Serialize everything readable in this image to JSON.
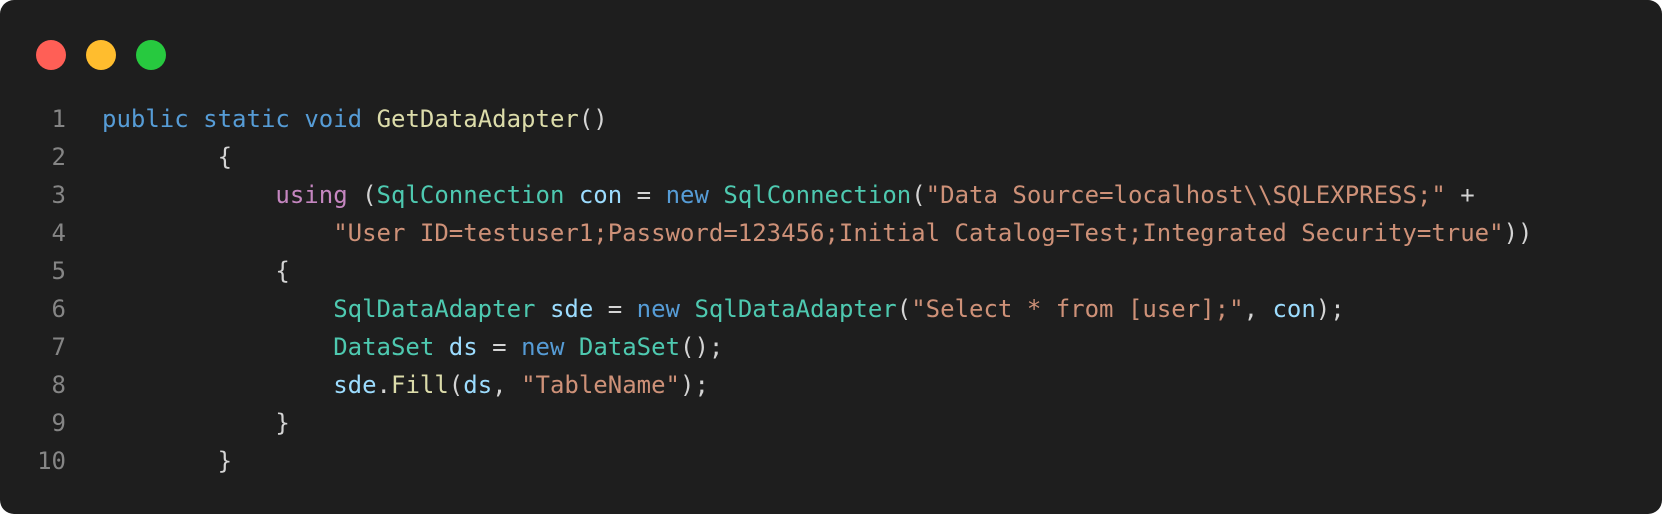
{
  "window": {
    "buttons": [
      {
        "name": "close",
        "color": "#ff5f56"
      },
      {
        "name": "minimize",
        "color": "#ffbd2e"
      },
      {
        "name": "maximize",
        "color": "#27c93f"
      }
    ]
  },
  "code": {
    "language": "csharp",
    "lines": [
      {
        "number": "1",
        "tokens": [
          {
            "t": "public",
            "k": "kw"
          },
          {
            "t": " ",
            "k": "pun"
          },
          {
            "t": "static",
            "k": "kw"
          },
          {
            "t": " ",
            "k": "pun"
          },
          {
            "t": "void",
            "k": "kw"
          },
          {
            "t": " ",
            "k": "pun"
          },
          {
            "t": "GetDataAdapter",
            "k": "fn"
          },
          {
            "t": "()",
            "k": "pun"
          }
        ]
      },
      {
        "number": "2",
        "tokens": [
          {
            "t": "        {",
            "k": "pun"
          }
        ]
      },
      {
        "number": "3",
        "tokens": [
          {
            "t": "            ",
            "k": "pun"
          },
          {
            "t": "using",
            "k": "ctrl"
          },
          {
            "t": " (",
            "k": "pun"
          },
          {
            "t": "SqlConnection",
            "k": "type"
          },
          {
            "t": " ",
            "k": "pun"
          },
          {
            "t": "con",
            "k": "var"
          },
          {
            "t": " = ",
            "k": "pun"
          },
          {
            "t": "new",
            "k": "kw"
          },
          {
            "t": " ",
            "k": "pun"
          },
          {
            "t": "SqlConnection",
            "k": "type"
          },
          {
            "t": "(",
            "k": "pun"
          },
          {
            "t": "\"Data Source=localhost\\\\SQLEXPRESS;\"",
            "k": "str"
          },
          {
            "t": " +",
            "k": "pun"
          }
        ]
      },
      {
        "number": "4",
        "tokens": [
          {
            "t": "                ",
            "k": "pun"
          },
          {
            "t": "\"User ID=testuser1;Password=123456;Initial Catalog=Test;Integrated Security=true\"",
            "k": "str"
          },
          {
            "t": "))",
            "k": "pun"
          }
        ]
      },
      {
        "number": "5",
        "tokens": [
          {
            "t": "            {",
            "k": "pun"
          }
        ]
      },
      {
        "number": "6",
        "tokens": [
          {
            "t": "                ",
            "k": "pun"
          },
          {
            "t": "SqlDataAdapter",
            "k": "type"
          },
          {
            "t": " ",
            "k": "pun"
          },
          {
            "t": "sde",
            "k": "var"
          },
          {
            "t": " = ",
            "k": "pun"
          },
          {
            "t": "new",
            "k": "kw"
          },
          {
            "t": " ",
            "k": "pun"
          },
          {
            "t": "SqlDataAdapter",
            "k": "type"
          },
          {
            "t": "(",
            "k": "pun"
          },
          {
            "t": "\"Select * from [user];\"",
            "k": "str"
          },
          {
            "t": ", ",
            "k": "pun"
          },
          {
            "t": "con",
            "k": "var"
          },
          {
            "t": ");",
            "k": "pun"
          }
        ]
      },
      {
        "number": "7",
        "tokens": [
          {
            "t": "                ",
            "k": "pun"
          },
          {
            "t": "DataSet",
            "k": "type"
          },
          {
            "t": " ",
            "k": "pun"
          },
          {
            "t": "ds",
            "k": "var"
          },
          {
            "t": " = ",
            "k": "pun"
          },
          {
            "t": "new",
            "k": "kw"
          },
          {
            "t": " ",
            "k": "pun"
          },
          {
            "t": "DataSet",
            "k": "type"
          },
          {
            "t": "();",
            "k": "pun"
          }
        ]
      },
      {
        "number": "8",
        "tokens": [
          {
            "t": "                ",
            "k": "pun"
          },
          {
            "t": "sde",
            "k": "var"
          },
          {
            "t": ".",
            "k": "pun"
          },
          {
            "t": "Fill",
            "k": "fn"
          },
          {
            "t": "(",
            "k": "pun"
          },
          {
            "t": "ds",
            "k": "var"
          },
          {
            "t": ", ",
            "k": "pun"
          },
          {
            "t": "\"TableName\"",
            "k": "str"
          },
          {
            "t": ");",
            "k": "pun"
          }
        ]
      },
      {
        "number": "9",
        "tokens": [
          {
            "t": "            }",
            "k": "pun"
          }
        ]
      },
      {
        "number": "10",
        "tokens": [
          {
            "t": "        }",
            "k": "pun"
          }
        ]
      }
    ]
  }
}
